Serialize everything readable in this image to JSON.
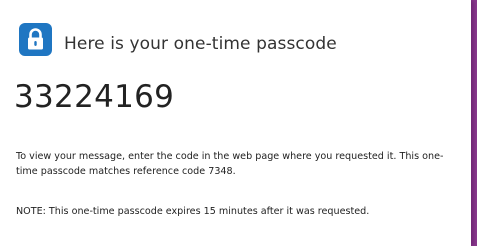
{
  "header": {
    "icon": "lock-icon",
    "icon_bg": "#1f76c2",
    "title": "Here is your one-time passcode"
  },
  "passcode": {
    "value": "33224169"
  },
  "message": {
    "instructions": "To view your message, enter the code in the web page where you requested it. This one-time passcode matches reference code 7348.",
    "note": "NOTE: This one-time passcode expires 15 minutes after it was requested."
  },
  "colors": {
    "accent": "#1f76c2",
    "border": "#8b3a8f",
    "text": "#222222"
  }
}
